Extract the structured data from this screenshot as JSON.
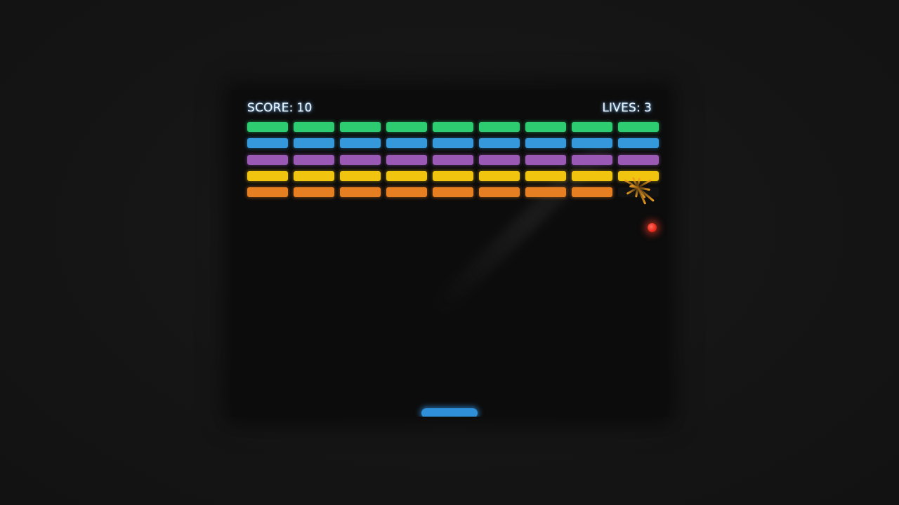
{
  "hud": {
    "score_label": "SCORE:",
    "score": 10,
    "lives_label": "LIVES:",
    "lives": 3
  },
  "bricks": {
    "columns": 9,
    "rows": [
      {
        "color": "#2ecc71",
        "name": "green"
      },
      {
        "color": "#3498db",
        "name": "blue"
      },
      {
        "color": "#9b59b6",
        "name": "purple"
      },
      {
        "color": "#f1c40f",
        "name": "yellow"
      },
      {
        "color": "#e67e22",
        "name": "orange"
      }
    ],
    "destroyed": [
      {
        "row": 4,
        "col": 8
      }
    ]
  },
  "ball": {
    "color": "#e8281c"
  },
  "paddle": {
    "color": "#2f8fd8"
  },
  "background_color": "#151515",
  "frame_color": "#0c0c0c"
}
